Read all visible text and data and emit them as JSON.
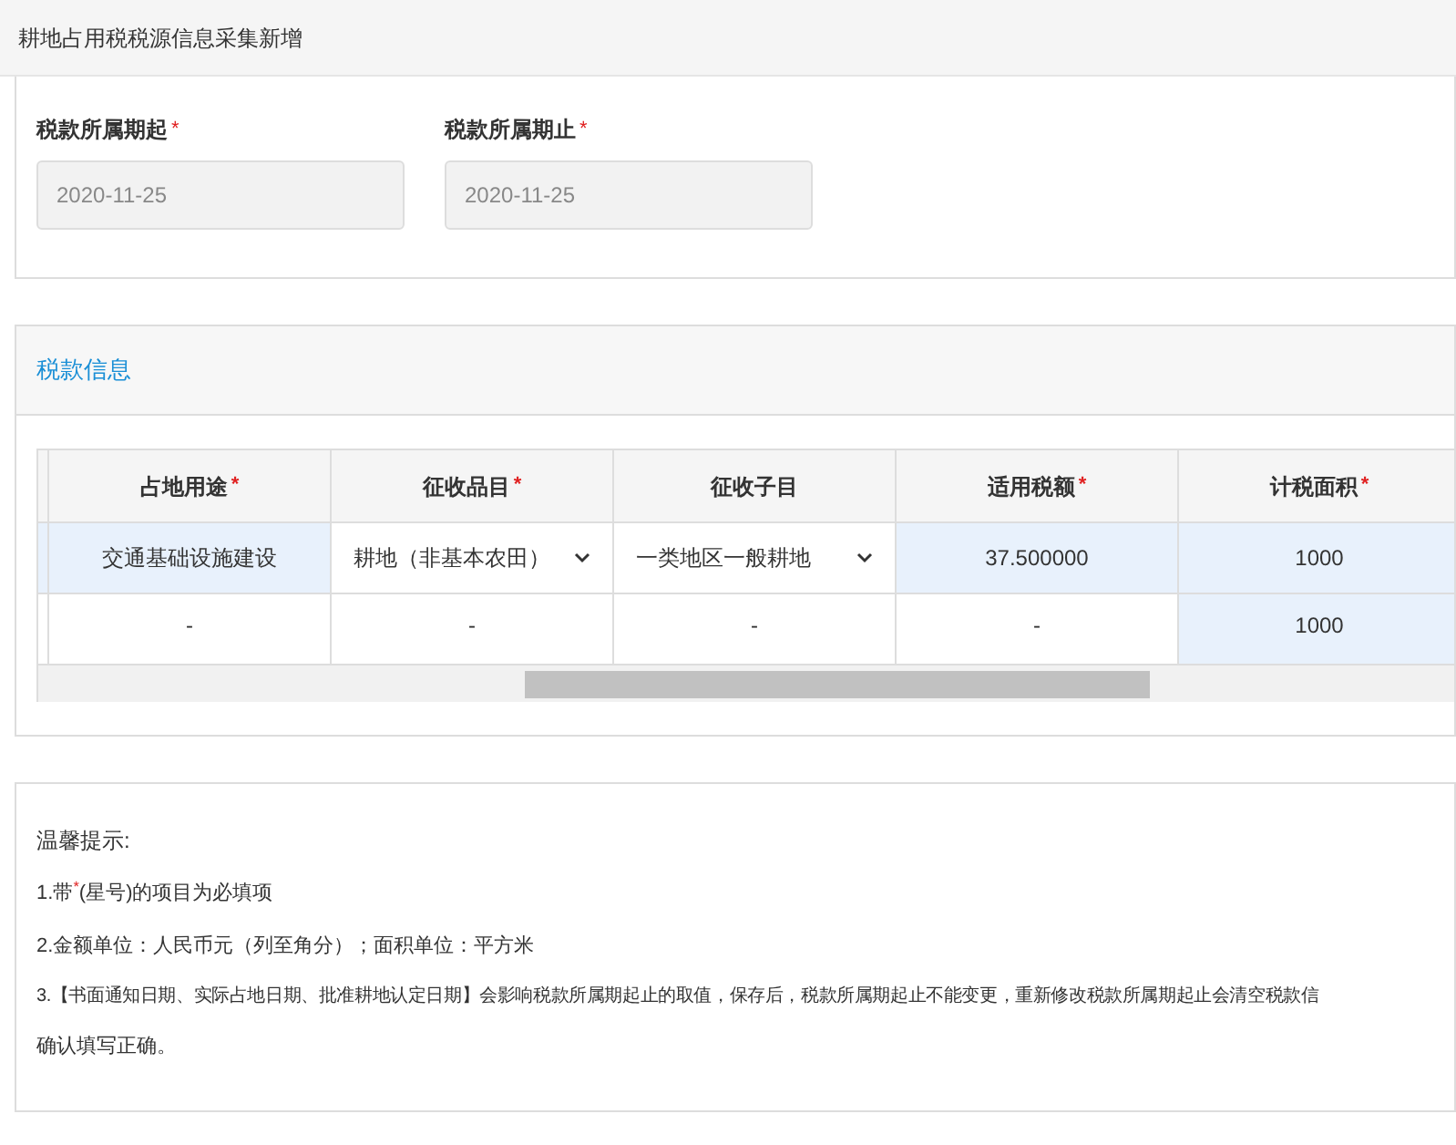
{
  "page_title": "耕地占用税税源信息采集新增",
  "period_fields": [
    {
      "label": "税款所属期起",
      "required_mark": "*",
      "value": "2020-11-25"
    },
    {
      "label": "税款所属期止",
      "required_mark": "*",
      "value": "2020-11-25"
    }
  ],
  "tax_section": {
    "title": "税款信息",
    "columns": [
      {
        "label": "占地用途",
        "required_mark": "*"
      },
      {
        "label": "征收品目",
        "required_mark": "*"
      },
      {
        "label": "征收子目"
      },
      {
        "label": "适用税额",
        "required_mark": "*"
      },
      {
        "label": "计税面积",
        "required_mark": "*"
      }
    ],
    "rows": [
      {
        "selected": true,
        "cells": [
          {
            "kind": "text",
            "value": "交通基础设施建设"
          },
          {
            "kind": "select",
            "value": "耕地（非基本农田）"
          },
          {
            "kind": "select",
            "value": "一类地区一般耕地"
          },
          {
            "kind": "text",
            "value": "37.500000"
          },
          {
            "kind": "text",
            "value": "1000"
          }
        ]
      },
      {
        "selected": false,
        "cells": [
          {
            "kind": "text",
            "value": "-"
          },
          {
            "kind": "text",
            "value": "-"
          },
          {
            "kind": "text",
            "value": "-"
          },
          {
            "kind": "text",
            "value": "-"
          },
          {
            "kind": "text",
            "value": "1000"
          }
        ]
      }
    ]
  },
  "tips": {
    "title": "温馨提示:",
    "items": [
      "1.带$^{*}$(星号)的项目为必填项",
      "2.金额单位：人民币元（列至角分）；面积单位：平方米",
      "3.【书面通知日期、实际占地日期、批准耕地认定日期】会影响税款所属期起止的取值，保存后，税款所属期起止不能变更，重新修改税款所属期起止会清空税款信",
      "确认填写正确。"
    ]
  }
}
